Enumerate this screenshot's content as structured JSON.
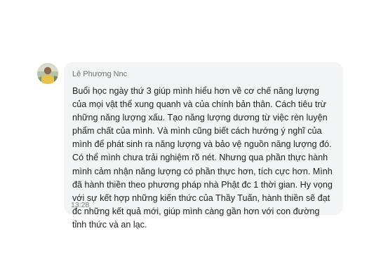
{
  "sender": {
    "name": "Lê Phương Nnc",
    "avatar_icon": "avatar-photo"
  },
  "message": {
    "text": "Buổi học ngày thứ 3 giúp mình hiểu hơn về cơ chế năng lượng của mọi vật thể xung quanh và của chính bản thân. Cách tiêu trừ những năng lượng xấu. Tạo năng lượng dương từ việc rèn luyện phẩm chất của mình. Và mình cũng biết cách hướng ý nghĩ của mình để phát sinh ra năng lượng và bảo vệ nguồn năng lượng đó. Có thể mình chưa trải nghiệm rõ nét. Nhưng qua phần thực hành mình cảm nhận năng lượng có phần thực hơn, tích cực hơn. Mình đã hành thiền theo phương pháp nhà Phật đc 1 thời gian. Hy vọng với sự kết hợp những kiến thức của Thầy Tuấn, hành thiền sẽ đạt đc những kết quả mới, giúp mình càng gần hơn với con đường tỉnh thức và an lạc.",
    "time": "13:28"
  },
  "colors": {
    "bubble_background": "#f3f4f6",
    "text": "#1d1f23",
    "meta_text": "#6b6f76"
  }
}
